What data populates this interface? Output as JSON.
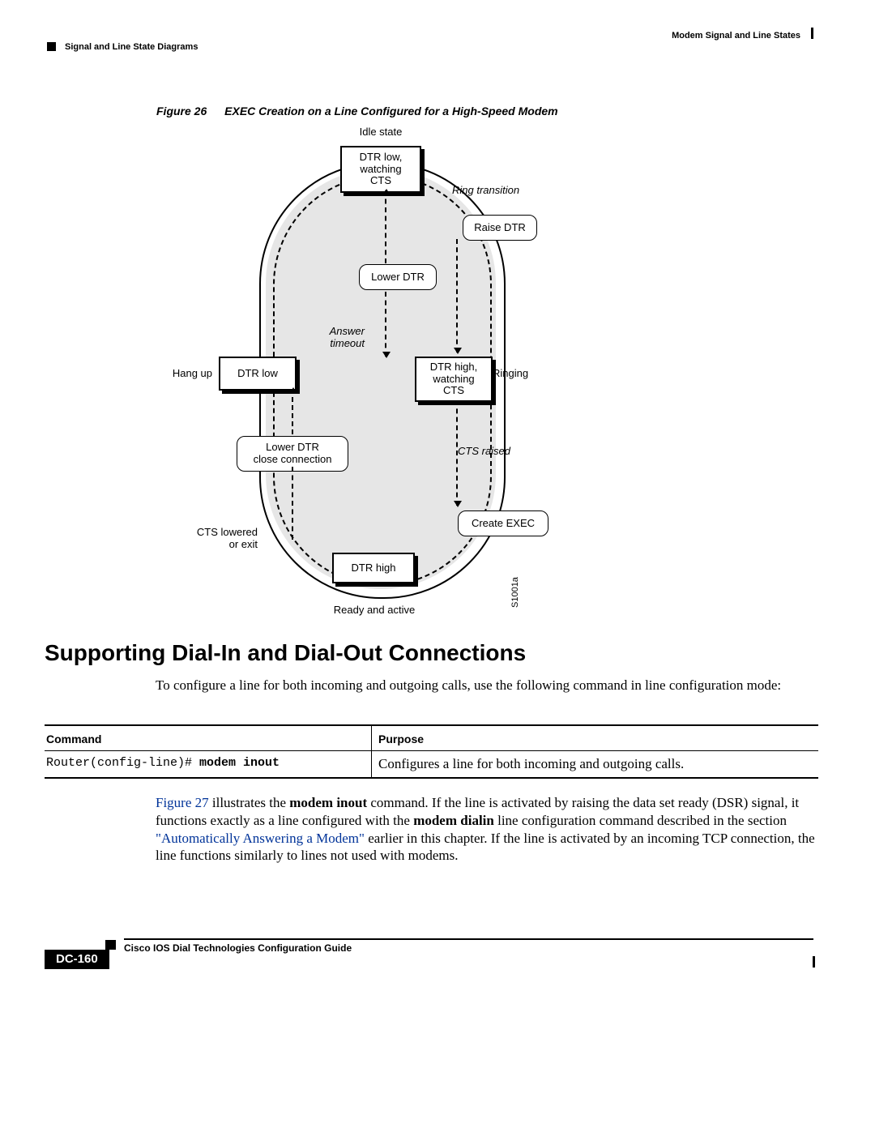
{
  "header": {
    "chapter": "Modem Signal and Line States",
    "section": "Signal and Line State Diagrams"
  },
  "figure": {
    "number": "Figure 26",
    "title": "EXEC Creation on a Line Configured for a High-Speed Modem",
    "imgcode": "S1001a",
    "labels": {
      "idle_state": "Idle state",
      "ring_transition": "Ring transition",
      "answer_timeout": "Answer\ntimeout",
      "hang_up": "Hang up",
      "ringing": "Ringing",
      "cts_raised": "CTS raised",
      "cts_lowered": "CTS lowered\nor exit",
      "ready_active": "Ready and active"
    },
    "states": {
      "idle": "DTR low,\nwatching\nCTS",
      "hang": "DTR low",
      "ring": "DTR high,\nwatching\nCTS",
      "active": "DTR high"
    },
    "actions": {
      "raise_dtr": "Raise DTR",
      "lower_dtr": "Lower DTR",
      "lower_close": "Lower DTR\nclose connection",
      "create_exec": "Create EXEC"
    }
  },
  "section_heading": "Supporting Dial-In and Dial-Out Connections",
  "intro_para": "To configure a line for both incoming and outgoing calls, use the following command in line configuration mode:",
  "table": {
    "hdr_cmd": "Command",
    "hdr_purpose": "Purpose",
    "row_cmd_prefix": "Router(config-line)# ",
    "row_cmd_bold": "modem inout",
    "row_purpose": "Configures a line for both incoming and outgoing calls."
  },
  "body2": {
    "fig_link": "Figure 27",
    "t1": " illustrates the ",
    "cmd1": "modem inout",
    "t2": " command. If the line is activated by raising the data set ready (DSR) signal, it functions exactly as a line configured with the ",
    "cmd2": "modem dialin",
    "t3": " line configuration command described in the section ",
    "link2": "\"Automatically Answering a Modem\"",
    "t4": " earlier in this chapter. If the line is activated by an incoming TCP connection, the line functions similarly to lines not used with modems."
  },
  "footer": {
    "guide": "Cisco IOS Dial Technologies Configuration Guide",
    "page": "DC-160"
  }
}
